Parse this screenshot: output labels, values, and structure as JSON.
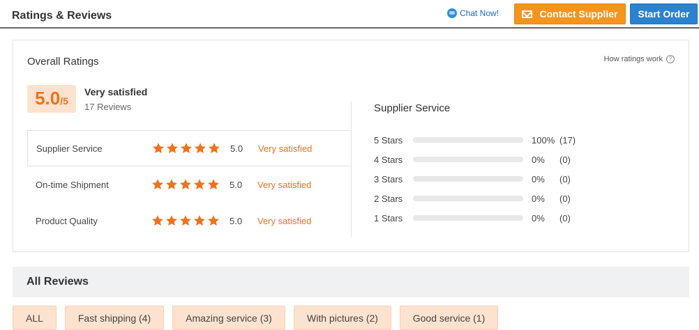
{
  "header": {
    "title": "Ratings & Reviews",
    "chat_label": "Chat Now!",
    "contact_label": "Contact Supplier",
    "order_label": "Start Order"
  },
  "overall": {
    "title": "Overall Ratings",
    "how_link": "How ratings work",
    "score": "5.0",
    "out_of": "/5",
    "verdict": "Very satisfied",
    "review_count": "17 Reviews"
  },
  "categories": [
    {
      "name": "Supplier Service",
      "score": "5.0",
      "verdict": "Very satisfied",
      "stars": 5
    },
    {
      "name": "On-time Shipment",
      "score": "5.0",
      "verdict": "Very satisfied",
      "stars": 5
    },
    {
      "name": "Product Quality",
      "score": "5.0",
      "verdict": "Very satisfied",
      "stars": 5
    }
  ],
  "distribution": {
    "title": "Supplier Service",
    "rows": [
      {
        "label": "5  Stars",
        "fraction": 1.0,
        "percent": "100%",
        "count": "(17)"
      },
      {
        "label": "4  Stars",
        "fraction": 0.0,
        "percent": "0%",
        "count": "(0)"
      },
      {
        "label": "3  Stars",
        "fraction": 0.0,
        "percent": "0%",
        "count": "(0)"
      },
      {
        "label": "2  Stars",
        "fraction": 0.0,
        "percent": "0%",
        "count": "(0)"
      },
      {
        "label": "1  Stars",
        "fraction": 0.0,
        "percent": "0%",
        "count": "(0)"
      }
    ]
  },
  "reviews": {
    "title": "All Reviews",
    "filters": [
      "ALL",
      "Fast shipping (4)",
      "Amazing service (3)",
      "With pictures (2)",
      "Good service (1)"
    ]
  },
  "colors": {
    "accent_orange": "#f0721b",
    "contact_button": "#f7941d",
    "order_button": "#2a82d0",
    "badge_bg": "#fde2cf"
  },
  "icons": [
    "chat-icon",
    "mail-icon",
    "question-icon",
    "star-icon"
  ]
}
